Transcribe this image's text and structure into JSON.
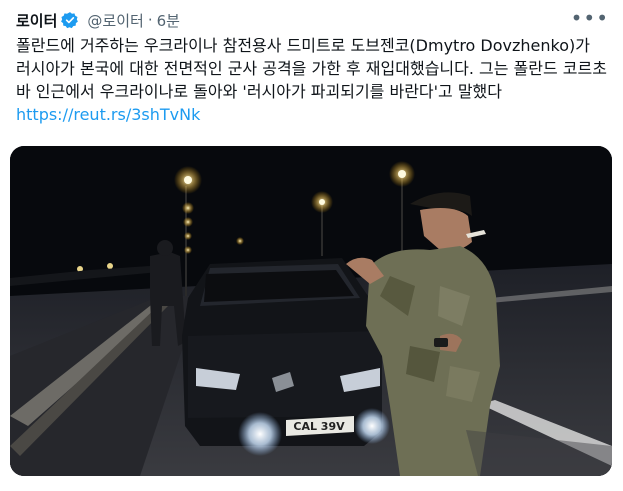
{
  "tweet": {
    "author_name": "로이터",
    "handle": "@로이터",
    "separator": "·",
    "time": "6분",
    "more_icon": "•••",
    "text_main": "폴란드에 거주하는 우크라이나 참전용사 드미트로 도브젠코(Dmytro Dovzhenko)가 러시아가 본국에 대한 전면적인 군사 공격을 가한 후 재입대했습니다. 그는 폴란드 코르초바 인근에서 우크라이나로 돌아와 '러시아가 파괴되기를 바란다'고 말했다 ",
    "link": "https://reut.rs/3shTvNk",
    "media": {
      "license_plate": "CAL 39V"
    }
  },
  "colors": {
    "link": "#1d9bf0",
    "verified": "#1d9bf0",
    "secondary_text": "#536471"
  },
  "icons": [
    "verified-badge-icon",
    "more-options-icon"
  ]
}
